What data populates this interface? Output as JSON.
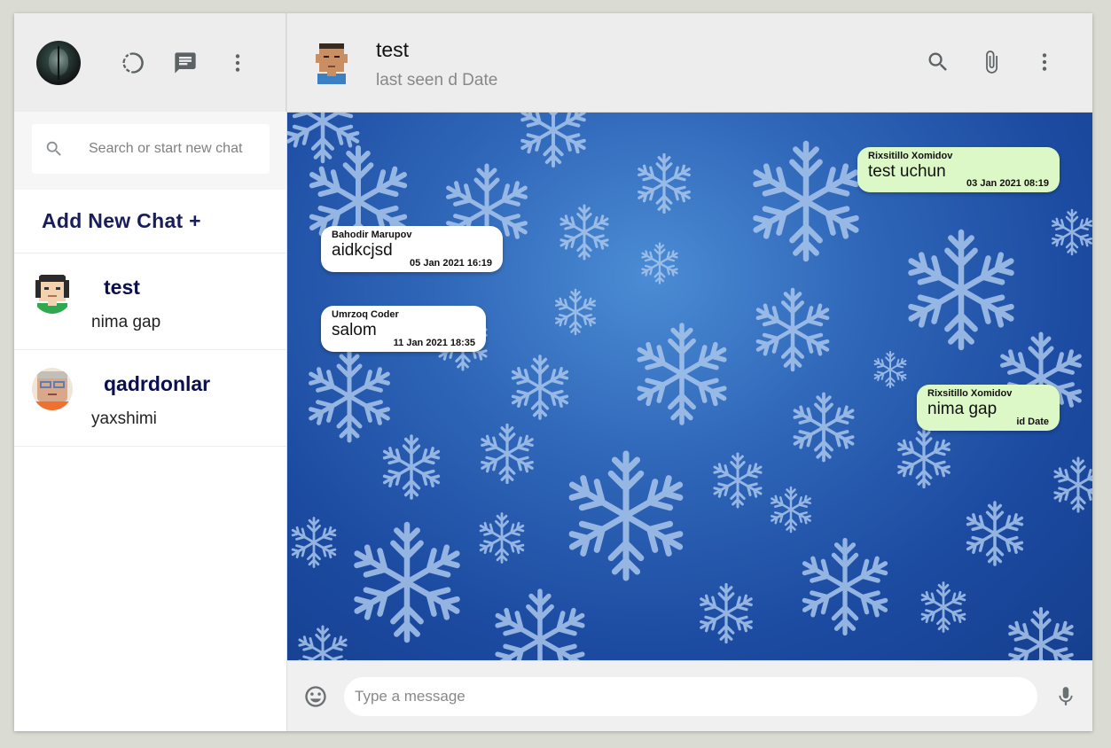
{
  "sidebar": {
    "search_placeholder": "Search or start new chat",
    "add_chat_label": "Add New Chat +",
    "chats": [
      {
        "name": "test",
        "last_message": "nima gap"
      },
      {
        "name": "qadrdonlar",
        "last_message": "yaxshimi"
      }
    ]
  },
  "header": {
    "contact_name": "test",
    "status": "last seen d Date"
  },
  "messages": [
    {
      "author": "Rixsitillo Xomidov",
      "text": "test uchun",
      "time": "03 Jan 2021 08:19",
      "type": "sent"
    },
    {
      "author": "Bahodir Marupov",
      "text": "aidkcjsd",
      "time": "05 Jan 2021 16:19",
      "type": "received"
    },
    {
      "author": "Umrzoq Coder",
      "text": "salom",
      "time": "11 Jan 2021 18:35",
      "type": "received"
    },
    {
      "author": "Rixsitillo Xomidov",
      "text": "nima gap",
      "time": "id Date",
      "type": "sent"
    }
  ],
  "composer": {
    "placeholder": "Type a message"
  },
  "icons": {
    "status": "status-icon",
    "new_chat": "chat-icon",
    "menu": "more-vertical-icon",
    "search": "search-icon",
    "attach": "paperclip-icon",
    "emoji": "emoji-icon",
    "mic": "microphone-icon"
  },
  "colors": {
    "sent_bubble": "#dcf8c6",
    "received_bubble": "#ffffff",
    "chat_name": "#0b0f4e",
    "header_bg": "#ededed"
  }
}
